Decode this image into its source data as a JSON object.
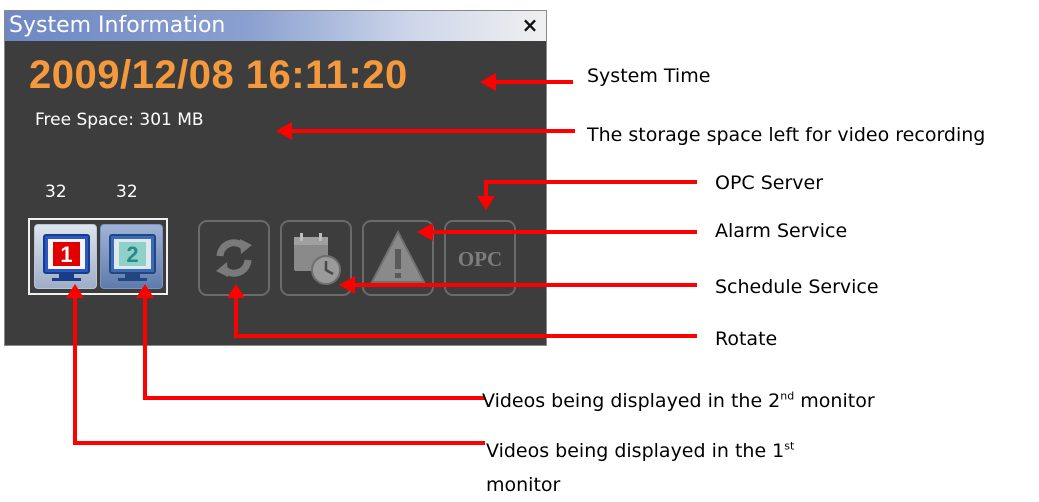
{
  "window": {
    "title": "System Information",
    "close_label": "×"
  },
  "status": {
    "system_time": "2009/12/08 16:11:20",
    "free_space": "Free Space:  301 MB"
  },
  "monitors": [
    {
      "count": "32",
      "number": "1",
      "icon": "monitor-1-icon"
    },
    {
      "count": "32",
      "number": "2",
      "icon": "monitor-2-icon"
    }
  ],
  "services": [
    {
      "name": "rotate",
      "icon": "rotate-icon"
    },
    {
      "name": "schedule",
      "icon": "schedule-icon"
    },
    {
      "name": "alarm",
      "icon": "alarm-warning-icon"
    },
    {
      "name": "opc",
      "icon": "opc-icon",
      "text": "OPC"
    }
  ],
  "annotations": {
    "system_time": "System Time",
    "storage": "The storage space left for video recording",
    "opc": "OPC Server",
    "alarm": "Alarm Service",
    "schedule": "Schedule Service",
    "rotate": "Rotate",
    "monitor2": {
      "before": "Videos being displayed in the 2",
      "sup": "nd",
      "after": " monitor"
    },
    "monitor1": {
      "before": "Videos being displayed in the 1",
      "sup": "st",
      "after": " monitor"
    }
  },
  "colors": {
    "accent_time": "#f59a3c",
    "panel_bg": "#3d3d3d",
    "arrow": "#ff0000",
    "monitor_number_1": "#e00000",
    "monitor_number_2": "#2a8a8a"
  }
}
